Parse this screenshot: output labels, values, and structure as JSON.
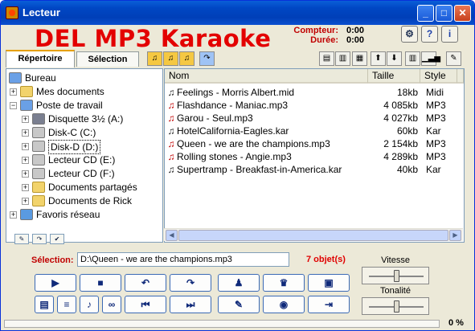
{
  "window": {
    "title": "Lecteur"
  },
  "logo": "DEL MP3 Karaoke",
  "counter": {
    "label": "Compteur:",
    "value": "0:00",
    "duration_label": "Durée:",
    "duration_value": "0:00"
  },
  "tabs": [
    {
      "label": "Répertoire",
      "active": true
    },
    {
      "label": "Sélection",
      "active": false
    }
  ],
  "tree": [
    {
      "label": "Bureau",
      "icon": "desktop-icon",
      "expander": ""
    },
    {
      "label": "Mes documents",
      "icon": "folder-icon",
      "expander": "+"
    },
    {
      "label": "Poste de travail",
      "icon": "computer-icon",
      "expander": "-"
    },
    {
      "label": "Disquette 3½ (A:)",
      "icon": "floppy-icon",
      "expander": "+"
    },
    {
      "label": "Disk-C (C:)",
      "icon": "drive-icon",
      "expander": "+"
    },
    {
      "label": "Disk-D (D:)",
      "icon": "drive-icon",
      "expander": "+",
      "selected": true
    },
    {
      "label": "Lecteur CD (E:)",
      "icon": "cd-icon",
      "expander": "+"
    },
    {
      "label": "Lecteur CD (F:)",
      "icon": "cd-icon",
      "expander": "+"
    },
    {
      "label": "Documents partagés",
      "icon": "folder-icon",
      "expander": "+"
    },
    {
      "label": "Documents de Rick",
      "icon": "folder-icon",
      "expander": "+"
    },
    {
      "label": "Favoris réseau",
      "icon": "network-icon",
      "expander": "+"
    }
  ],
  "files": {
    "headers": {
      "name": "Nom",
      "size": "Taille",
      "style": "Style"
    },
    "rows": [
      {
        "name": "Feelings - Morris Albert.mid",
        "size": "18kb",
        "style": "Midi",
        "icon_color": "#222222"
      },
      {
        "name": "Flashdance - Maniac.mp3",
        "size": "4 085kb",
        "style": "MP3",
        "icon_color": "#c00000"
      },
      {
        "name": "Garou - Seul.mp3",
        "size": "4 027kb",
        "style": "MP3",
        "icon_color": "#c00000"
      },
      {
        "name": "HotelCalifornia-Eagles.kar",
        "size": "60kb",
        "style": "Kar",
        "icon_color": "#222222"
      },
      {
        "name": "Queen - we are the champions.mp3",
        "size": "2 154kb",
        "style": "MP3",
        "icon_color": "#c00000"
      },
      {
        "name": "Rolling stones - Angie.mp3",
        "size": "4 289kb",
        "style": "MP3",
        "icon_color": "#c00000"
      },
      {
        "name": "Supertramp - Breakfast-in-America.kar",
        "size": "40kb",
        "style": "Kar",
        "icon_color": "#222222"
      }
    ]
  },
  "selection": {
    "label": "Sélection:",
    "value": "D:\\Queen - we are the champions.mp3",
    "count": "7 objet(s)"
  },
  "speed": {
    "label": "Vitesse",
    "level": 0.5
  },
  "pitch": {
    "label": "Tonalité",
    "level": 0.5
  },
  "progress": {
    "percent_text": "0 %",
    "value": 0
  },
  "colors": {
    "titlebar": "#0047c4",
    "accent": "#e30000",
    "label_red": "#c00000"
  },
  "symbols": {
    "play": "▶",
    "stop": "■",
    "undo": "↶",
    "redo": "↷",
    "prev": "⏮",
    "next": "⏭",
    "minimize": "_",
    "maximize": "□",
    "close": "✕",
    "gear": "⚙",
    "help": "?",
    "info": "i",
    "exp_plus": "+",
    "exp_minus": "−",
    "note": "♫",
    "scroll_left": "◀",
    "scroll_right": "▶"
  }
}
